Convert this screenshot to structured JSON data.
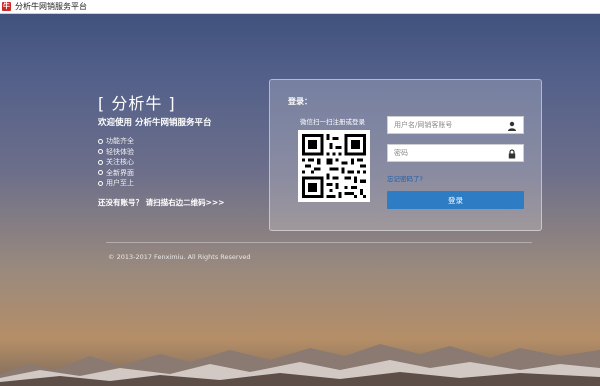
{
  "window": {
    "title": "分析牛网销服务平台",
    "favicon_icon": "fenximiu-logo-icon",
    "favicon_letter": "牛"
  },
  "brand": {
    "name": "[ 分析牛 ]"
  },
  "intro": {
    "welcome": "欢迎使用 分析牛网销服务平台",
    "features": [
      "功能齐全",
      "轻快体验",
      "关注核心",
      "全新界面",
      "用户至上"
    ],
    "no_account": "还没有账号？ 请扫描右边二维码>>>"
  },
  "login": {
    "title": "登录：",
    "qr_hint": "微信扫一扫注册或登录",
    "username_placeholder": "用户名/网销客账号",
    "password_placeholder": "密码",
    "username_icon": "user-icon",
    "password_icon": "lock-icon",
    "forgot_label": "忘记密码了?",
    "submit_label": "登录",
    "accent_color": "#2d7cc4"
  },
  "footer": {
    "copyright": "© 2013-2017 Fenximiu. All Rights Reserved"
  }
}
